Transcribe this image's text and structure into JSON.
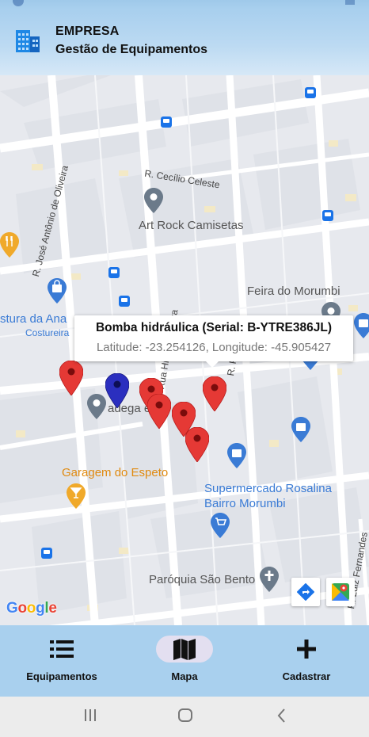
{
  "app": {
    "company": "EMPRESA",
    "subtitle": "Gestão de Equipamentos"
  },
  "map": {
    "labels": {
      "art_rock": "Art Rock Camisetas",
      "feira": "Feira do Morumbi",
      "costura": "stura da Ana",
      "costureira": "Costureira",
      "adega": "adega e",
      "garagem": "Garagem do Espeto",
      "supermercado_1": "Supermercado Rosalina",
      "supermercado_2": "Bairro Morumbi",
      "paroquia": "Paróquia São Bento",
      "rua_cecilio": "R. Cecílio Celeste",
      "rua_jose": "R. José Antônio de Oliveira",
      "rua_hilton": "Rua Hilton da Silva",
      "rua_pindola": "R. Pindola",
      "rua_r": "Rua",
      "rua_luiz": "R. Luiz Fernandes"
    },
    "popup": {
      "title": "Bomba hidráulica (Serial: B-YTRE386JL)",
      "coords": "Latitude: -23.254126, Longitude: -45.905427"
    },
    "attribution": [
      "G",
      "o",
      "o",
      "g",
      "l",
      "e"
    ],
    "colors": {
      "marker_red": "#e53935",
      "marker_blue": "#2b2fbf",
      "poi_gray": "#6b7a8a",
      "poi_blue": "#3a7bd5",
      "poi_orange": "#f0a92a"
    }
  },
  "nav": {
    "items": [
      {
        "label": "Equipamentos",
        "icon": "list-icon",
        "active": false
      },
      {
        "label": "Mapa",
        "icon": "map-icon",
        "active": true
      },
      {
        "label": "Cadastrar",
        "icon": "plus-icon",
        "active": false
      }
    ]
  },
  "system_nav": [
    "recents-icon",
    "home-icon",
    "back-icon"
  ]
}
